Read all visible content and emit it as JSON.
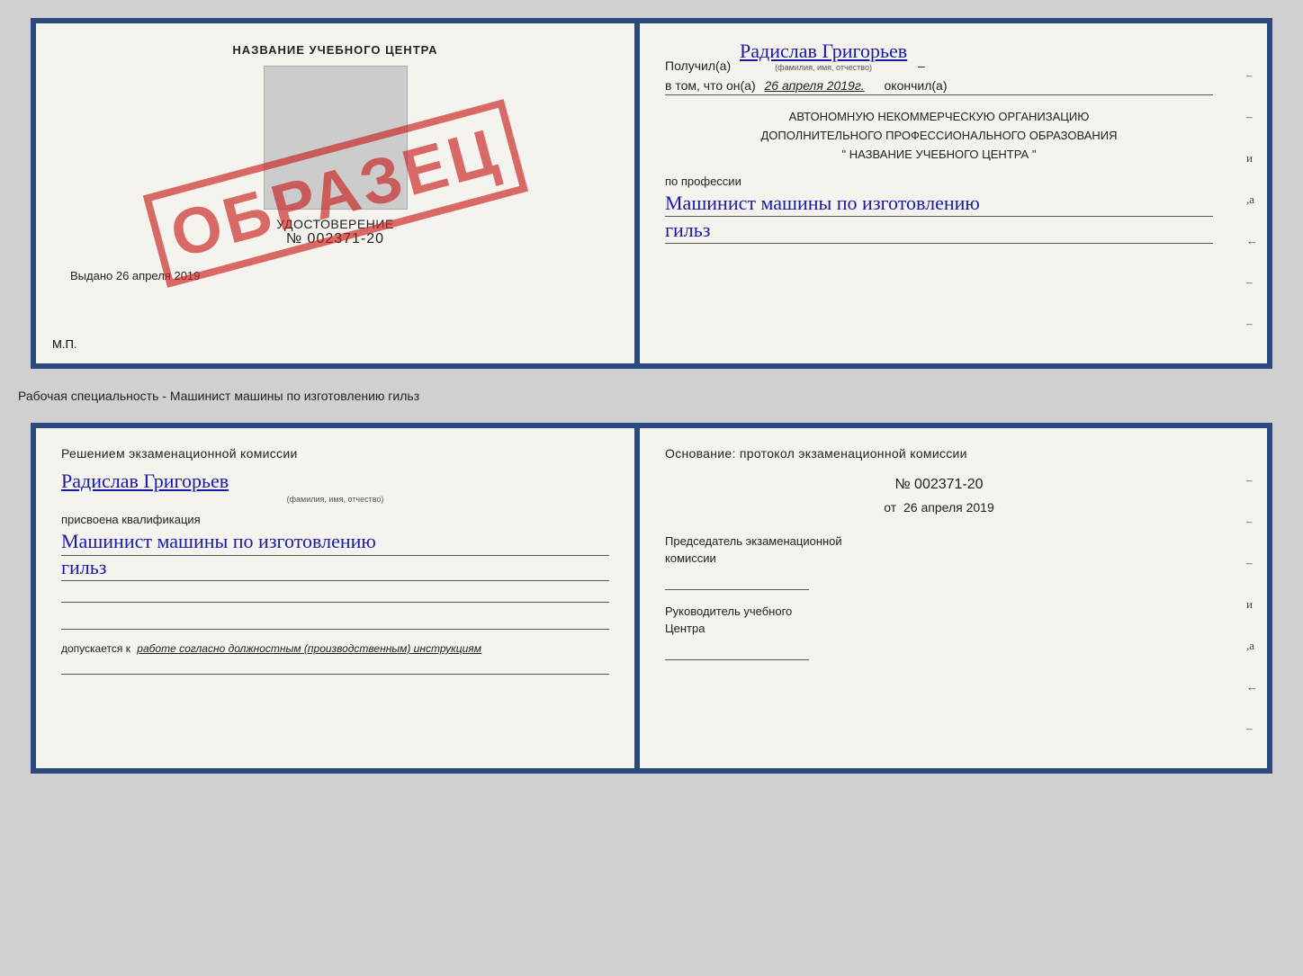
{
  "top": {
    "left": {
      "title": "НАЗВАНИЕ УЧЕБНОГО ЦЕНТРА",
      "udost_label": "УДОСТОВЕРЕНИЕ",
      "number": "№ 002371-20",
      "vydano": "Выдано 26 апреля 2019",
      "mp": "М.П.",
      "stamp_text": "ОБРАЗЕЦ"
    },
    "right": {
      "poluchil_prefix": "Получил(а)",
      "name": "Радислав Григорьев",
      "name_subtitle": "(фамилия, имя, отчество)",
      "vtom_prefix": "в том, что он(а)",
      "vtom_date": "26 апреля 2019г.",
      "okончил": "окончил(а)",
      "org_line1": "АВТОНОМНУЮ НЕКОММЕРЧЕСКУЮ ОРГАНИЗАЦИЮ",
      "org_line2": "ДОПОЛНИТЕЛЬНОГО ПРОФЕССИОНАЛЬНОГО ОБРАЗОВАНИЯ",
      "org_line3": "\"   НАЗВАНИЕ УЧЕБНОГО ЦЕНТРА   \"",
      "po_professii": "по профессии",
      "prof_name": "Машинист машины по изготовлению",
      "prof_name2": "гильз"
    }
  },
  "between_label": "Рабочая специальность - Машинист машины по изготовлению гильз",
  "bottom": {
    "left": {
      "resheniem": "Решением  экзаменационной  комиссии",
      "name": "Радислав Григорьев",
      "name_subtitle": "(фамилия, имя, отчество)",
      "prisvoena": "присвоена квалификация",
      "kvalif1": "Машинист  машины  по  изготовлению",
      "kvalif2": "гильз",
      "dopusk_prefix": "допускается к",
      "dopusk_italic": "работе согласно должностным (производственным) инструкциям"
    },
    "right": {
      "osnovanie": "Основание: протокол экзаменационной  комиссии",
      "number": "№  002371-20",
      "date_prefix": "от",
      "date": "26 апреля 2019",
      "predsedatel1": "Председатель экзаменационной",
      "predsedatel2": "комиссии",
      "rukovoditel1": "Руководитель учебного",
      "rukovoditel2": "Центра"
    }
  }
}
